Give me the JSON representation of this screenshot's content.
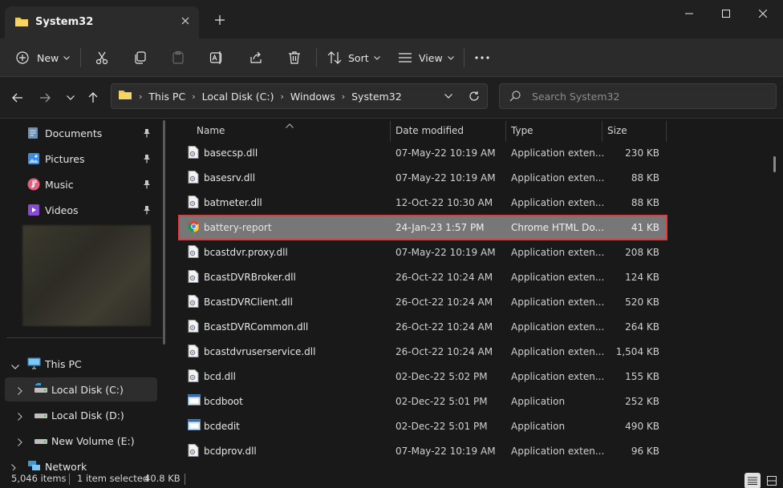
{
  "window": {
    "tab_title": "System32",
    "icons": {
      "folder": "folder-icon",
      "close_tab": "close-icon",
      "new_tab": "plus-icon",
      "minimize": "minimize-icon",
      "maximize": "maximize-icon",
      "close": "close-icon"
    }
  },
  "toolbar": {
    "new_label": "New",
    "sort_label": "Sort",
    "view_label": "View",
    "icons": [
      "cut-icon",
      "copy-icon",
      "paste-icon",
      "rename-icon",
      "share-icon",
      "delete-icon",
      "more-icon"
    ]
  },
  "address": {
    "crumbs": [
      "This PC",
      "Local Disk (C:)",
      "Windows",
      "System32"
    ]
  },
  "search": {
    "placeholder": "Search System32"
  },
  "sidebar": {
    "quick_access": [
      {
        "label": "Documents",
        "icon": "documents-icon"
      },
      {
        "label": "Pictures",
        "icon": "pictures-icon"
      },
      {
        "label": "Music",
        "icon": "music-icon"
      },
      {
        "label": "Videos",
        "icon": "videos-icon"
      }
    ],
    "this_pc": "This PC",
    "drives": [
      "Local Disk (C:)",
      "Local Disk (D:)",
      "New Volume (E:)"
    ],
    "network": "Network"
  },
  "columns": {
    "name": "Name",
    "date": "Date modified",
    "type": "Type",
    "size": "Size"
  },
  "files": [
    {
      "name": "basecsp.dll",
      "date": "07-May-22 10:19 AM",
      "type": "Application exten...",
      "size": "230 KB",
      "icon": "dll"
    },
    {
      "name": "basesrv.dll",
      "date": "07-May-22 10:19 AM",
      "type": "Application exten...",
      "size": "88 KB",
      "icon": "dll"
    },
    {
      "name": "batmeter.dll",
      "date": "12-Oct-22 10:30 AM",
      "type": "Application exten...",
      "size": "88 KB",
      "icon": "dll"
    },
    {
      "name": "battery-report",
      "date": "24-Jan-23 1:57 PM",
      "type": "Chrome HTML Do...",
      "size": "41 KB",
      "icon": "chrome"
    },
    {
      "name": "bcastdvr.proxy.dll",
      "date": "07-May-22 10:19 AM",
      "type": "Application exten...",
      "size": "208 KB",
      "icon": "dll"
    },
    {
      "name": "BcastDVRBroker.dll",
      "date": "26-Oct-22 10:24 AM",
      "type": "Application exten...",
      "size": "124 KB",
      "icon": "dll"
    },
    {
      "name": "BcastDVRClient.dll",
      "date": "26-Oct-22 10:24 AM",
      "type": "Application exten...",
      "size": "520 KB",
      "icon": "dll"
    },
    {
      "name": "BcastDVRCommon.dll",
      "date": "26-Oct-22 10:24 AM",
      "type": "Application exten...",
      "size": "264 KB",
      "icon": "dll"
    },
    {
      "name": "bcastdvruserservice.dll",
      "date": "26-Oct-22 10:24 AM",
      "type": "Application exten...",
      "size": "1,504 KB",
      "icon": "dll"
    },
    {
      "name": "bcd.dll",
      "date": "02-Dec-22 5:02 PM",
      "type": "Application exten...",
      "size": "155 KB",
      "icon": "dll"
    },
    {
      "name": "bcdboot",
      "date": "02-Dec-22 5:01 PM",
      "type": "Application",
      "size": "252 KB",
      "icon": "exe"
    },
    {
      "name": "bcdedit",
      "date": "02-Dec-22 5:01 PM",
      "type": "Application",
      "size": "490 KB",
      "icon": "exe"
    },
    {
      "name": "bcdprov.dll",
      "date": "07-May-22 10:19 AM",
      "type": "Application exten...",
      "size": "96 KB",
      "icon": "dll"
    }
  ],
  "status": {
    "item_count": "5,046 items",
    "selection": "1 item selected",
    "selection_size": "40.8 KB"
  },
  "colors": {
    "selected_row": "#777777",
    "highlight_border": "#e03c3c",
    "background": "#191919"
  }
}
